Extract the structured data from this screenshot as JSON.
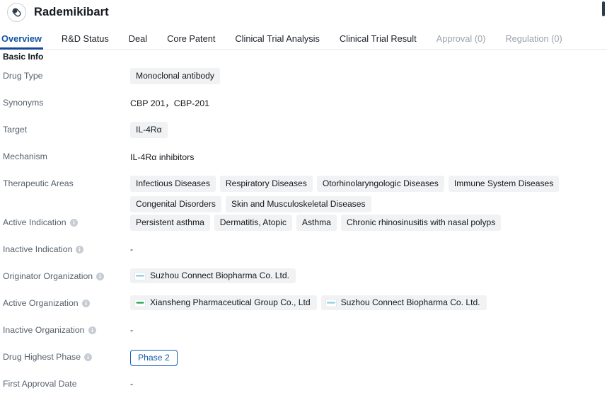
{
  "header": {
    "drug_name": "Rademikibart",
    "avatar_icon": "capsule-pill-icon"
  },
  "tabs": [
    {
      "label": "Overview",
      "state": "active"
    },
    {
      "label": "R&D Status",
      "state": "normal"
    },
    {
      "label": "Deal",
      "state": "normal"
    },
    {
      "label": "Core Patent",
      "state": "normal"
    },
    {
      "label": "Clinical Trial Analysis",
      "state": "normal"
    },
    {
      "label": "Clinical Trial Result",
      "state": "normal"
    },
    {
      "label": "Approval (0)",
      "state": "disabled"
    },
    {
      "label": "Regulation (0)",
      "state": "disabled"
    }
  ],
  "section": {
    "title": "Basic Info"
  },
  "fields": {
    "drug_type": {
      "label": "Drug Type",
      "chips": [
        "Monoclonal antibody"
      ]
    },
    "synonyms": {
      "label": "Synonyms",
      "text": "CBP 201，CBP-201"
    },
    "target": {
      "label": "Target",
      "chips": [
        "IL-4Rα"
      ]
    },
    "mechanism": {
      "label": "Mechanism",
      "text": "IL-4Rα inhibitors"
    },
    "therapeutic_areas": {
      "label": "Therapeutic Areas",
      "chips": [
        "Infectious Diseases",
        "Respiratory Diseases",
        "Otorhinolaryngologic Diseases",
        "Immune System Diseases",
        "Congenital Disorders",
        "Skin and Musculoskeletal Diseases"
      ]
    },
    "active_indication": {
      "label": "Active Indication",
      "has_info": true,
      "chips": [
        "Persistent asthma",
        "Dermatitis, Atopic",
        "Asthma",
        "Chronic rhinosinusitis with nasal polyps"
      ]
    },
    "inactive_indication": {
      "label": "Inactive Indication",
      "has_info": true,
      "text": "-"
    },
    "originator_organization": {
      "label": "Originator Organization",
      "has_info": true,
      "orgs": [
        {
          "name": "Suzhou Connect Biopharma Co. Ltd.",
          "logo_color": "#8fcfe4"
        }
      ]
    },
    "active_organization": {
      "label": "Active Organization",
      "has_info": true,
      "orgs": [
        {
          "name": "Xiansheng Pharmaceutical Group Co., Ltd",
          "logo_color": "#18a04a"
        },
        {
          "name": "Suzhou Connect Biopharma Co. Ltd.",
          "logo_color": "#8fcfe4"
        }
      ]
    },
    "inactive_organization": {
      "label": "Inactive Organization",
      "has_info": true,
      "text": "-"
    },
    "drug_highest_phase": {
      "label": "Drug Highest Phase",
      "has_info": true,
      "badge": "Phase 2"
    },
    "first_approval_date": {
      "label": "First Approval Date",
      "has_info": false,
      "text": "-"
    }
  },
  "colors": {
    "accent_blue": "#16489a",
    "tab_active": "#1255a0",
    "label_grey": "#58616d",
    "chip_bg": "#f1f2f4",
    "phase_blue": "#1558a8"
  }
}
